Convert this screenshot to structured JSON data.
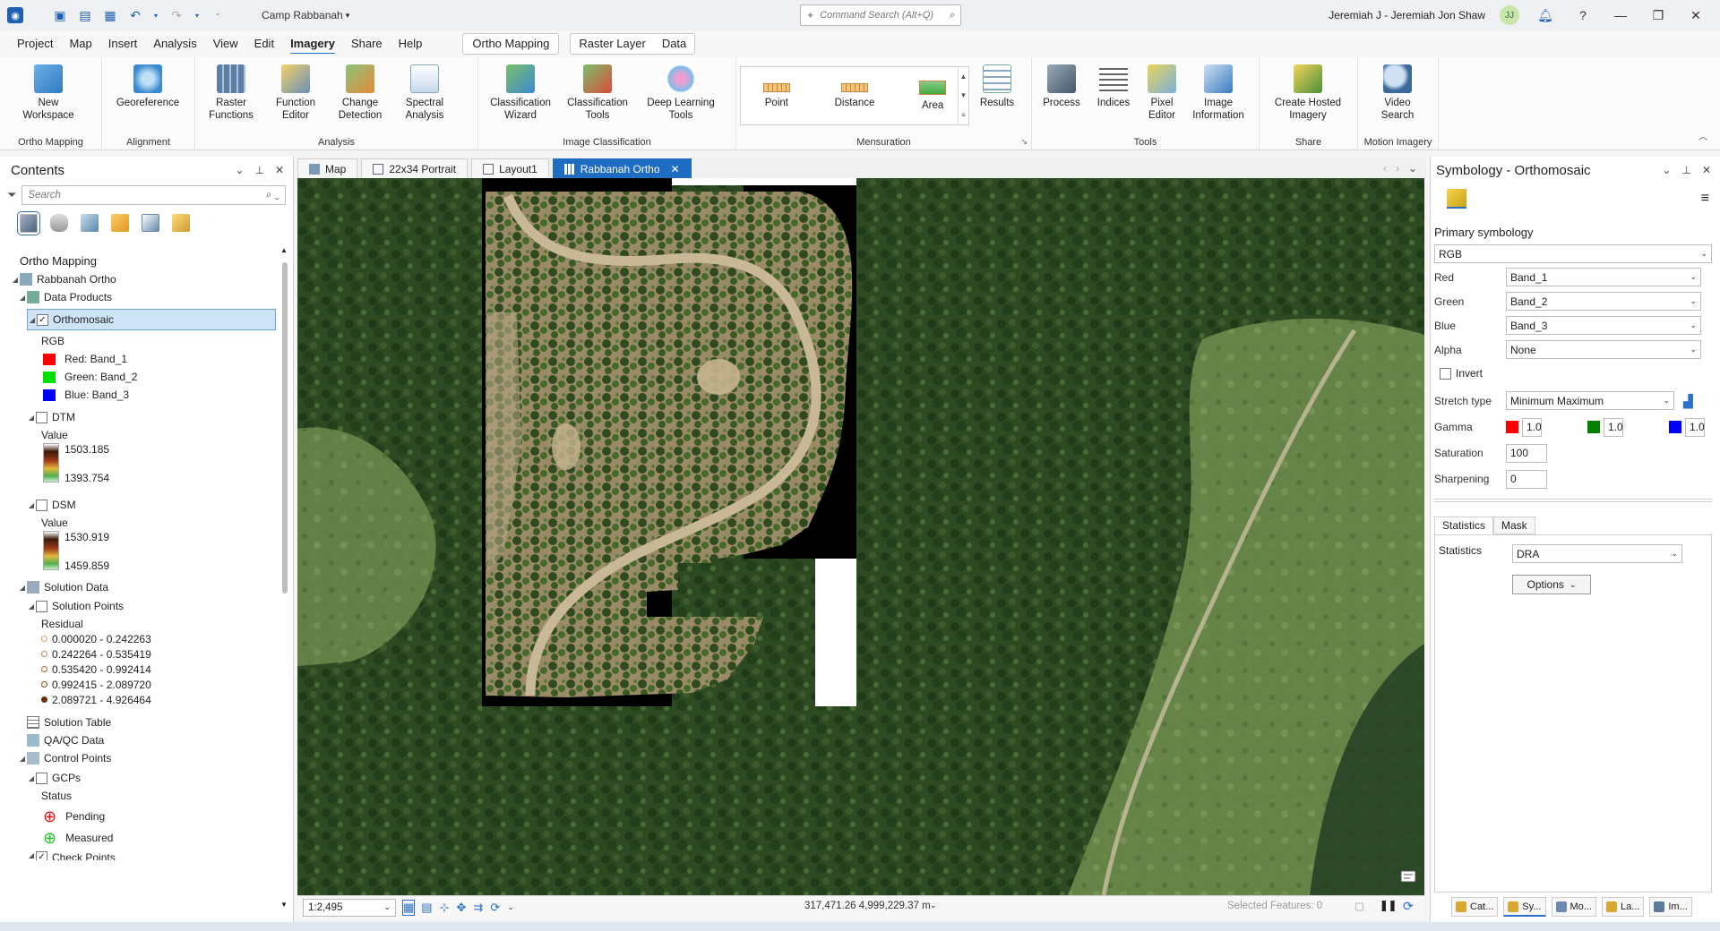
{
  "titlebar": {
    "project": "Camp Rabbanah",
    "search_placeholder": "Command Search (Alt+Q)",
    "user": "Jeremiah J - Jeremiah Jon Shaw",
    "initials": "JJ"
  },
  "ribbon_tabs": [
    "Project",
    "Map",
    "Insert",
    "Analysis",
    "View",
    "Edit",
    "Imagery",
    "Share",
    "Help"
  ],
  "active_tab": "Imagery",
  "contextual_tabs": {
    "ortho": "Ortho Mapping",
    "raster_layer": "Raster Layer",
    "data": "Data"
  },
  "ribbon": {
    "new_workspace": "New Workspace",
    "georeference": "Georeference",
    "raster_functions": "Raster Functions",
    "function_editor": "Function Editor",
    "change_detection": "Change Detection",
    "spectral_analysis": "Spectral Analysis",
    "classification_wizard": "Classification Wizard",
    "classification_tools": "Classification Tools",
    "deep_learning_tools": "Deep Learning Tools",
    "point": "Point",
    "distance": "Distance",
    "area": "Area",
    "results": "Results",
    "process": "Process",
    "indices": "Indices",
    "pixel_editor": "Pixel Editor",
    "image_information": "Image Information",
    "create_hosted_imagery": "Create Hosted Imagery",
    "video_search": "Video Search",
    "groups": {
      "ortho_mapping": "Ortho Mapping",
      "alignment": "Alignment",
      "analysis": "Analysis",
      "image_classification": "Image Classification",
      "mensuration": "Mensuration",
      "tools": "Tools",
      "share": "Share",
      "motion_imagery": "Motion Imagery"
    }
  },
  "contents": {
    "title": "Contents",
    "search_placeholder": "Search",
    "section": "Ortho Mapping",
    "workspace": "Rabbanah Ortho",
    "data_products": "Data Products",
    "orthomosaic": "Orthomosaic",
    "rgb": "RGB",
    "red": "Red:   Band_1",
    "green": "Green: Band_2",
    "blue": "Blue:  Band_3",
    "dtm": "DTM",
    "dtm_value": "Value",
    "dtm_max": "1503.185",
    "dtm_min": "1393.754",
    "dsm": "DSM",
    "dsm_value": "Value",
    "dsm_max": "1530.919",
    "dsm_min": "1459.859",
    "solution_data": "Solution Data",
    "solution_points": "Solution Points",
    "residual": "Residual",
    "residual_classes": [
      "0.000020 - 0.242263",
      "0.242264 - 0.535419",
      "0.535420 - 0.992414",
      "0.992415 - 2.089720",
      "2.089721 - 4.926464"
    ],
    "solution_table": "Solution Table",
    "qaqc": "QA/QC Data",
    "control_points": "Control Points",
    "gcps": "GCPs",
    "status": "Status",
    "pending": "Pending",
    "measured": "Measured",
    "check_points": "Check Points"
  },
  "view_tabs": [
    "Map",
    "22x34 Portrait",
    "Layout1",
    "Rabbanah Ortho"
  ],
  "active_view": "Rabbanah Ortho",
  "map_status": {
    "scale": "1:2,495",
    "coords": "317,471.26 4,999,229.37 m",
    "selected_features": "Selected Features: 0"
  },
  "symbology": {
    "title": "Symbology - Orthomosaic",
    "primary": "Primary symbology",
    "renderer": "RGB",
    "red_label": "Red",
    "red_value": "Band_1",
    "green_label": "Green",
    "green_value": "Band_2",
    "blue_label": "Blue",
    "blue_value": "Band_3",
    "alpha_label": "Alpha",
    "alpha_value": "None",
    "invert": "Invert",
    "stretch_label": "Stretch type",
    "stretch_value": "Minimum Maximum",
    "gamma_label": "Gamma",
    "gamma_r": "1.0",
    "gamma_g": "1.0",
    "gamma_b": "1.0",
    "saturation_label": "Saturation",
    "saturation_value": "100",
    "sharpening_label": "Sharpening",
    "sharpening_value": "0",
    "tab_statistics": "Statistics",
    "tab_mask": "Mask",
    "statistics_label": "Statistics",
    "statistics_value": "DRA",
    "options": "Options"
  },
  "bottom_tabs": [
    "Cat...",
    "Sy...",
    "Mo...",
    "La...",
    "Im..."
  ],
  "colors": {
    "accent": "#1f6dc2",
    "red": "#ff0000",
    "green": "#00e000",
    "blue": "#0000ff"
  }
}
